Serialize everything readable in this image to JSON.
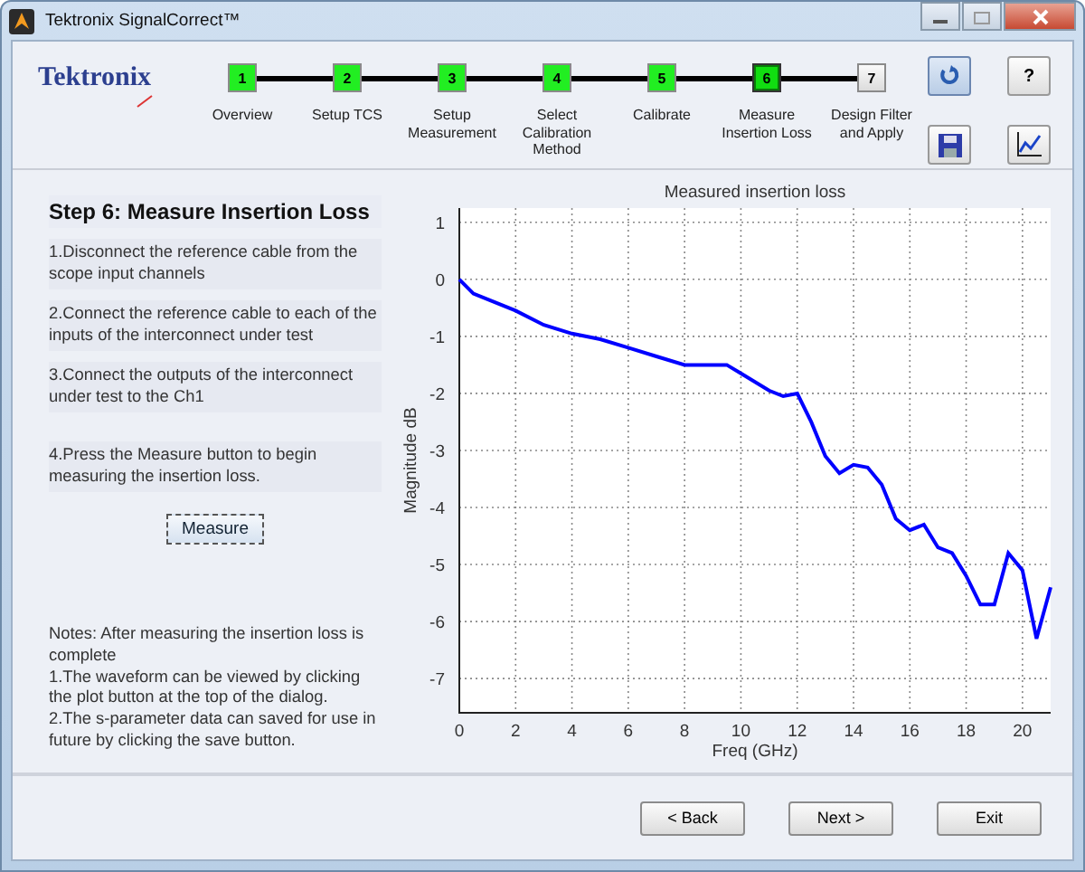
{
  "window": {
    "title": "Tektronix SignalCorrect™"
  },
  "logo": "Tektronix",
  "steps": [
    {
      "number": "1",
      "label": "Overview",
      "completed": true,
      "selected": false
    },
    {
      "number": "2",
      "label": "Setup TCS",
      "completed": true,
      "selected": false
    },
    {
      "number": "3",
      "label": "Setup Measurement",
      "completed": true,
      "selected": false
    },
    {
      "number": "4",
      "label": "Select Calibration Method",
      "completed": true,
      "selected": false
    },
    {
      "number": "5",
      "label": "Calibrate",
      "completed": true,
      "selected": false
    },
    {
      "number": "6",
      "label": "Measure Insertion Loss",
      "completed": true,
      "selected": true
    },
    {
      "number": "7",
      "label": "Design Filter and Apply",
      "completed": false,
      "selected": false
    }
  ],
  "toolbar": [
    {
      "kind": "refresh",
      "pressed": true
    },
    {
      "kind": "help",
      "text": "?",
      "pressed": false
    },
    {
      "kind": "save",
      "pressed": false
    },
    {
      "kind": "plot",
      "pressed": false
    }
  ],
  "panel": {
    "title": "Step 6: Measure Insertion Loss",
    "instructions": [
      "1.Disconnect the reference cable from the scope input channels",
      "2.Connect the reference cable to each of the inputs of the interconnect under test",
      "3.Connect the outputs of the interconnect under test to the Ch1",
      "4.Press the Measure button to begin measuring the insertion loss."
    ],
    "measure_button": "Measure",
    "notes": [
      "Notes: After measuring the insertion loss is complete",
      "1.The waveform can be viewed by clicking the plot button at the top of the dialog.",
      "2.The s-parameter data can saved for use in future by clicking the save button."
    ]
  },
  "chart": {
    "chart_data": {
      "type": "line",
      "title": "Measured insertion loss",
      "xlabel": "Freq (GHz)",
      "ylabel": "Magnitude dB",
      "x": [
        0,
        0.5,
        1,
        2,
        3,
        4,
        5,
        6,
        7,
        8,
        9,
        9.5,
        10,
        11,
        11.5,
        12,
        12.5,
        13,
        13.5,
        14,
        14.5,
        15,
        15.5,
        16,
        16.5,
        17,
        17.5,
        18,
        18.5,
        19,
        19.5,
        20,
        20.5,
        21
      ],
      "grid": true,
      "series": [
        {
          "color": "#0000ff",
          "values": [
            0,
            -0.25,
            -0.35,
            -0.55,
            -0.8,
            -0.95,
            -1.05,
            -1.2,
            -1.35,
            -1.5,
            -1.5,
            -1.5,
            -1.65,
            -1.95,
            -2.05,
            -2.0,
            -2.5,
            -3.1,
            -3.4,
            -3.25,
            -3.3,
            -3.6,
            -4.2,
            -4.4,
            -4.3,
            -4.7,
            -4.8,
            -5.2,
            -5.7,
            -5.7,
            -4.8,
            -5.1,
            -6.3,
            -5.4
          ]
        }
      ],
      "xlim": [
        0,
        21
      ],
      "ylim": [
        -7.6,
        1.25
      ],
      "xticks": [
        0,
        2,
        4,
        6,
        8,
        10,
        12,
        14,
        16,
        18,
        20
      ],
      "yticks": [
        -7,
        -6,
        -5,
        -4,
        -3,
        -2,
        -1,
        0,
        1
      ]
    }
  },
  "buttons": [
    "< Back",
    "Next >",
    "Exit"
  ]
}
